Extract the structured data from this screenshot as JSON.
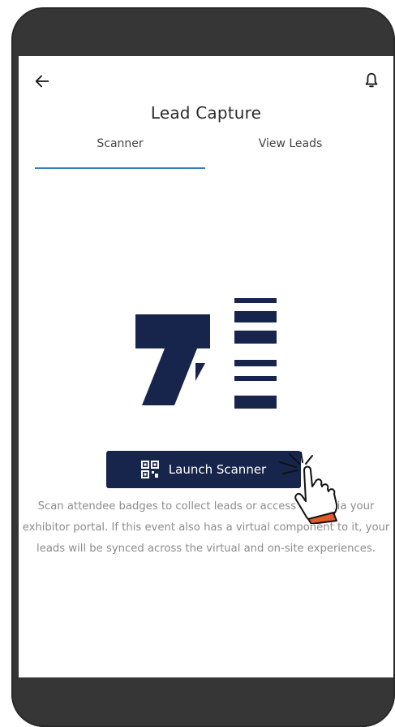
{
  "header": {
    "title": "Lead Capture"
  },
  "tabs": [
    {
      "label": "Scanner",
      "active": true
    },
    {
      "label": "View Leads",
      "active": false
    }
  ],
  "scanner": {
    "button_label": "Launch Scanner",
    "description": "Scan attendee badges to collect leads or access them via your exhibitor portal. If this event also has a virtual component to it, your leads will be synced across the virtual and on-site experiences."
  },
  "colors": {
    "frame": "#363636",
    "accent_navy": "#17254d",
    "tab_underline": "#2f7fc1",
    "muted_text": "#8c8c8c"
  },
  "icons": [
    "back-arrow-icon",
    "bell-icon",
    "barcode-scanner-icon",
    "qr-code-icon",
    "pointer-hand-icon"
  ]
}
